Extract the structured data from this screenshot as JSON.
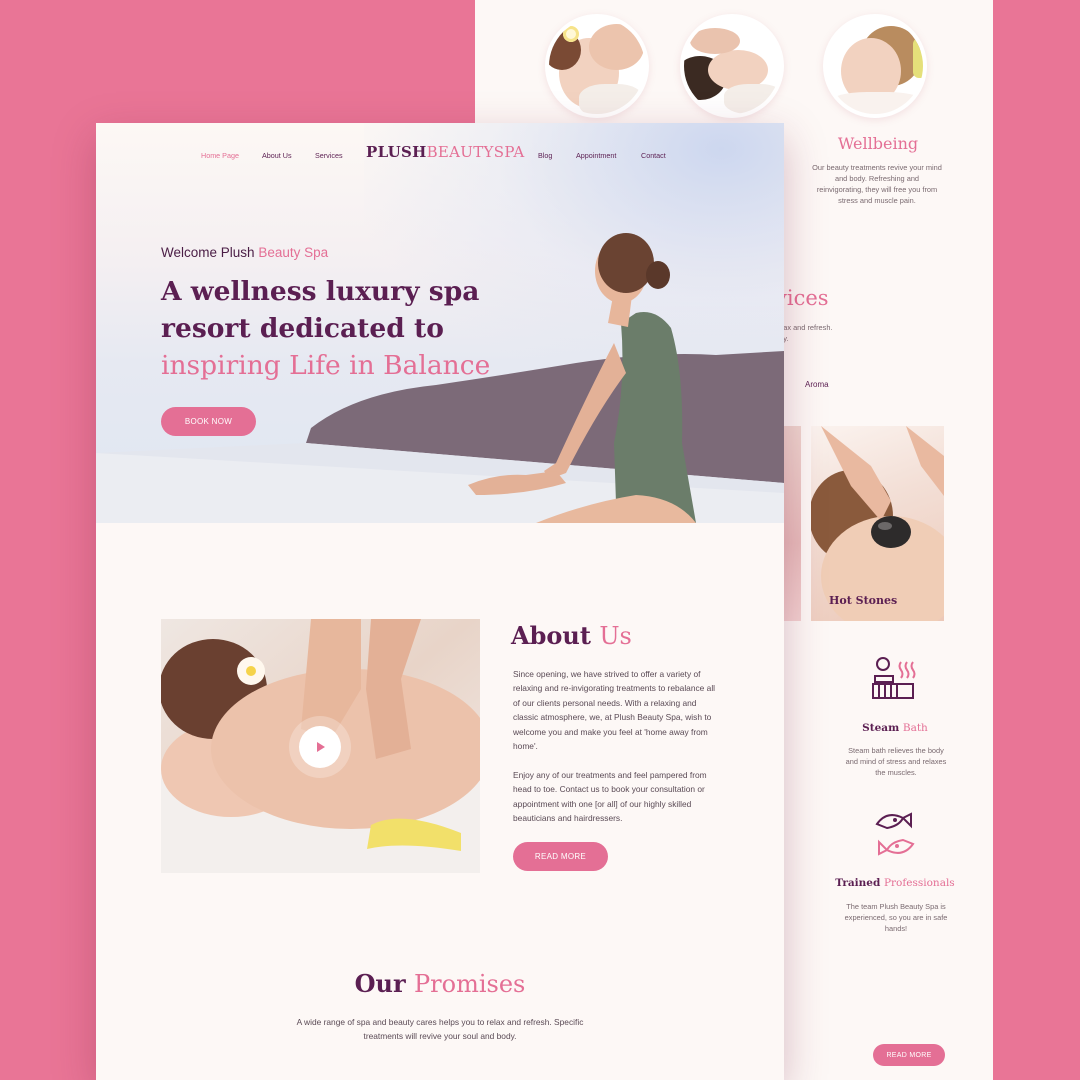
{
  "colors": {
    "background": "#e97596",
    "accent": "#e46f95",
    "plum": "#5b1f52",
    "page": "#fdf8f6"
  },
  "nav": {
    "left": [
      "Home Page",
      "About Us",
      "Services"
    ],
    "right": [
      "Blog",
      "Appointment",
      "Contact"
    ],
    "logo_a": "PLUSH",
    "logo_b": "BEAUTYSPA"
  },
  "hero": {
    "welcome_a": "Welcome Plush",
    "welcome_b": "Beauty Spa",
    "line1": "A wellness luxury spa",
    "line2": "resort dedicated to",
    "line3": "inspiring Life in Balance",
    "cta": "BOOK NOW"
  },
  "about": {
    "title_a": "About",
    "title_b": "Us",
    "p1": "Since opening, we have strived to offer a variety of relaxing and re-invigorating treatments to rebalance all of our clients personal needs. With a relaxing and classic atmosphere, we, at Plush Beauty Spa, wish to welcome you and make you feel at 'home away from home'.",
    "p2": "Enjoy any of our treatments and feel pampered from head to toe. Contact us to book your consultation or appointment with one [or all] of our highly skilled beauticians and hairdressers.",
    "cta": "READ MORE",
    "play_icon": "play-icon"
  },
  "promises": {
    "title_a": "Our",
    "title_b": "Promises",
    "text": "A wide range of spa and beauty cares helps you to relax and refresh. Specific treatments will revive your soul and body."
  },
  "back": {
    "wellbeing_title": "Wellbeing",
    "wellbeing_text": "Our beauty treatments revive your mind and body. Refreshing and reinvigorating, they will free you from stress and muscle pain.",
    "services_title": "vices",
    "services_text_1": "relax and refresh.",
    "services_text_2": "ody.",
    "aroma": "Aroma",
    "hot_stones": "Hot Stones",
    "steam_a": "Steam",
    "steam_b": "Bath",
    "steam_text": "Steam bath relieves the body and mind of stress and relaxes the muscles.",
    "pro_a": "Trained",
    "pro_b": "Professionals",
    "pro_text": "The team Plush Beauty Spa is experienced, so you are in safe hands!",
    "cta": "READ MORE"
  }
}
